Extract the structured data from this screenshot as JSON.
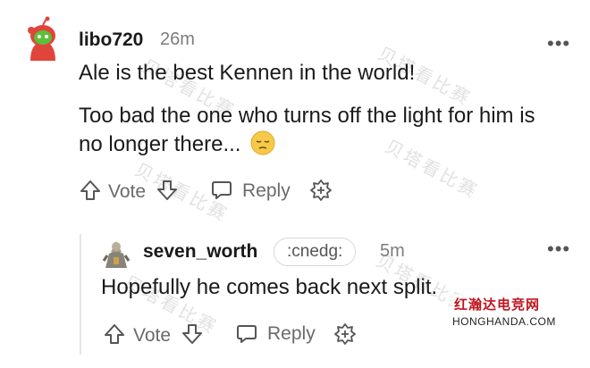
{
  "comment": {
    "username": "libo720",
    "time": "26m",
    "more": "•••",
    "body_line1": "Ale is the best Kennen in the world!",
    "body_line2": "Too bad the one who turns off the light for him is",
    "body_line3": "no longer there...",
    "emoji": "pensive-face",
    "actions": {
      "vote_label": "Vote",
      "reply_label": "Reply"
    }
  },
  "reply": {
    "username": "seven_worth",
    "flair": ":cnedg:",
    "time": "5m",
    "more": "•••",
    "body": "Hopefully he comes back next split.",
    "actions": {
      "vote_label": "Vote",
      "reply_label": "Reply"
    }
  },
  "watermark": {
    "text": "贝塔看比赛"
  },
  "stamp": {
    "chinese": "红瀚达电竞网",
    "domain": "HONGHANDA.COM"
  },
  "colors": {
    "text": "#1a1a1b",
    "meta": "#7c7c7c",
    "stamp_red": "#c0141e",
    "avatar_green": "#5dbf3a",
    "avatar_red": "#e0443a"
  }
}
